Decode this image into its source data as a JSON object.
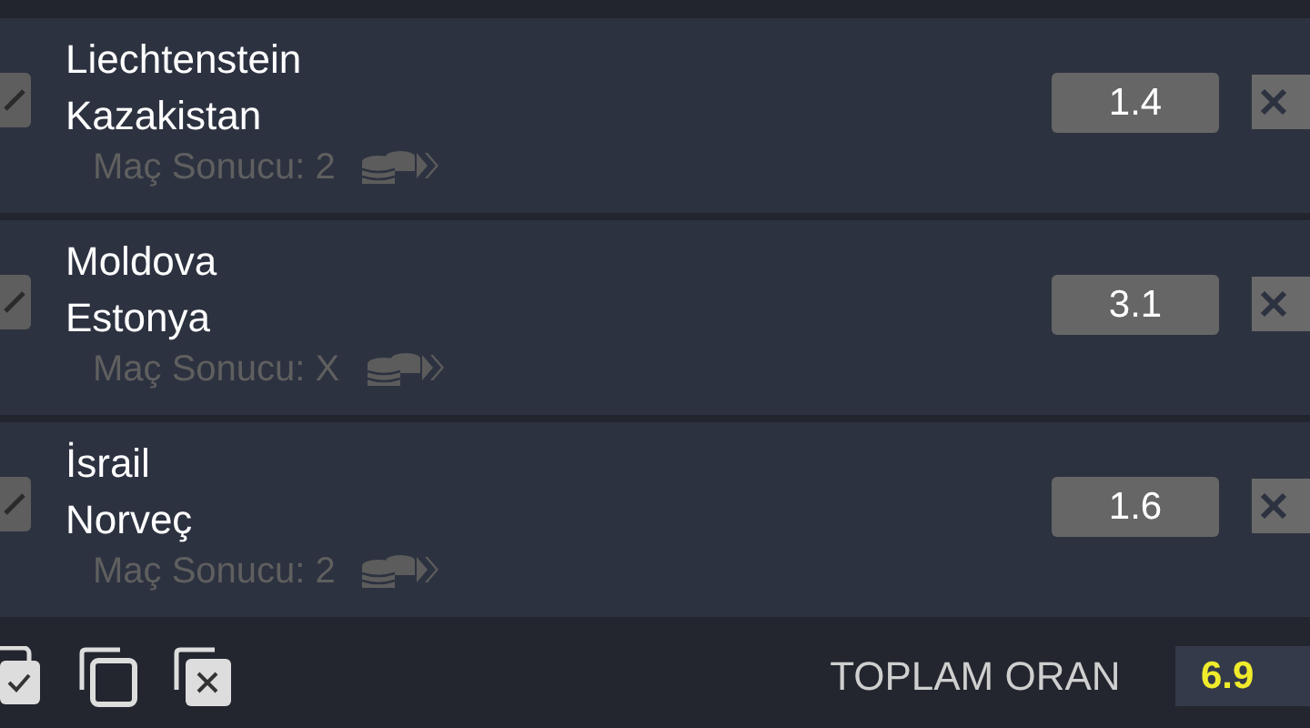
{
  "selections": [
    {
      "home": "Liechtenstein",
      "away": "Kazakistan",
      "market": "Maç Sonucu: 2",
      "odds": "1.4",
      "checked": true
    },
    {
      "home": "Moldova",
      "away": "Estonya",
      "market": "Maç Sonucu: X",
      "odds": "3.1",
      "checked": true
    },
    {
      "home": "İsrail",
      "away": "Norveç",
      "market": "Maç Sonucu: 2",
      "odds": "1.6",
      "checked": true
    }
  ],
  "footer": {
    "total_label": "TOPLAM ORAN",
    "total_value": "6.9"
  }
}
